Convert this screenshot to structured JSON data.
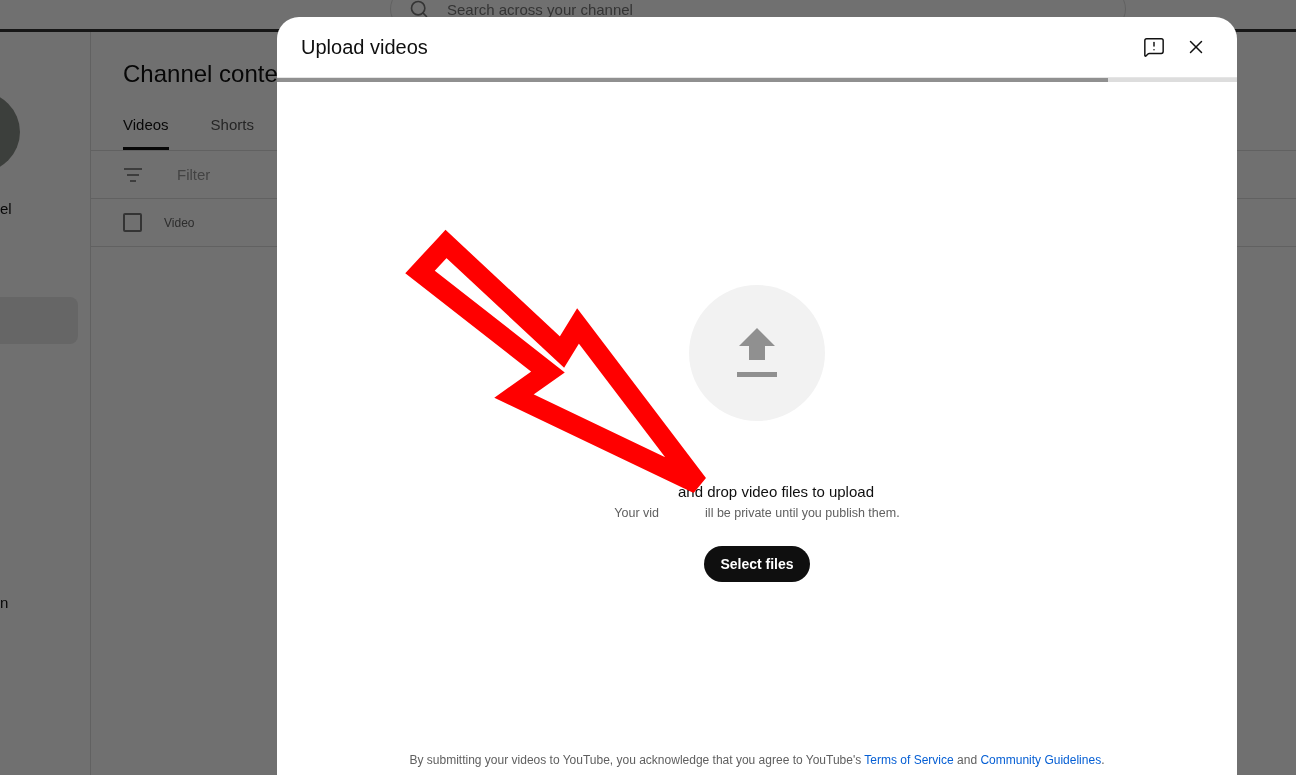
{
  "header": {
    "search_placeholder": "Search across your channel"
  },
  "sidebar": {
    "channel_name": "el",
    "item_fragment": "n"
  },
  "content": {
    "title": "Channel conte",
    "tabs": [
      {
        "label": "Videos",
        "selected": true
      },
      {
        "label": "Shorts",
        "selected": false
      }
    ],
    "filter_placeholder": "Filter",
    "table": {
      "select_all_checked": false,
      "columns": [
        "Video"
      ]
    }
  },
  "dialog": {
    "title": "Upload videos",
    "progress": {
      "level": 0.866
    },
    "prompt": "and drop video files to upload",
    "note_parts": [
      "Your vid",
      "ill be private until you publish them."
    ],
    "button": "Select files",
    "footer": [
      {
        "kind": "text",
        "text": "By submitting your videos to YouTube, you acknowledge that you agree to YouTube's"
      },
      {
        "kind": "link",
        "text": "Terms of Service"
      },
      {
        "kind": "text",
        "text": "and"
      },
      {
        "kind": "link",
        "text": "Community Guidelines"
      },
      {
        "kind": "text",
        "text": "."
      }
    ]
  }
}
